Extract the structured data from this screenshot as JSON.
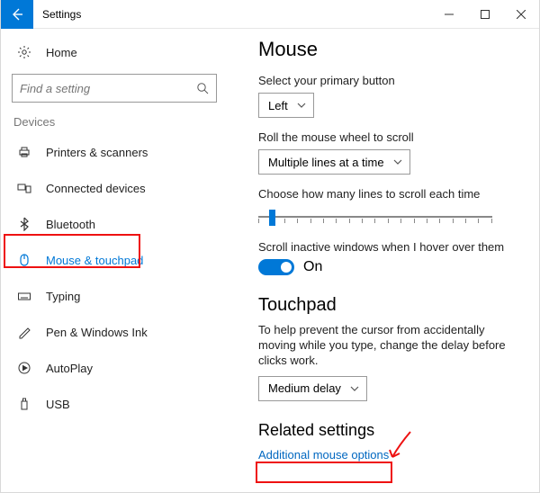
{
  "titlebar": {
    "app_title": "Settings"
  },
  "sidebar": {
    "home_label": "Home",
    "search_placeholder": "Find a setting",
    "group_label": "Devices",
    "items": [
      {
        "label": "Printers & scanners"
      },
      {
        "label": "Connected devices"
      },
      {
        "label": "Bluetooth"
      },
      {
        "label": "Mouse & touchpad"
      },
      {
        "label": "Typing"
      },
      {
        "label": "Pen & Windows Ink"
      },
      {
        "label": "AutoPlay"
      },
      {
        "label": "USB"
      }
    ]
  },
  "main": {
    "mouse_heading": "Mouse",
    "primary_button_label": "Select your primary button",
    "primary_button_value": "Left",
    "wheel_label": "Roll the mouse wheel to scroll",
    "wheel_value": "Multiple lines at a time",
    "lines_label": "Choose how many lines to scroll each time",
    "inactive_label": "Scroll inactive windows when I hover over them",
    "inactive_value": "On",
    "touchpad_heading": "Touchpad",
    "touchpad_help": "To help prevent the cursor from accidentally moving while you type, change the delay before clicks work.",
    "touchpad_value": "Medium delay",
    "related_heading": "Related settings",
    "additional_link": "Additional mouse options"
  }
}
